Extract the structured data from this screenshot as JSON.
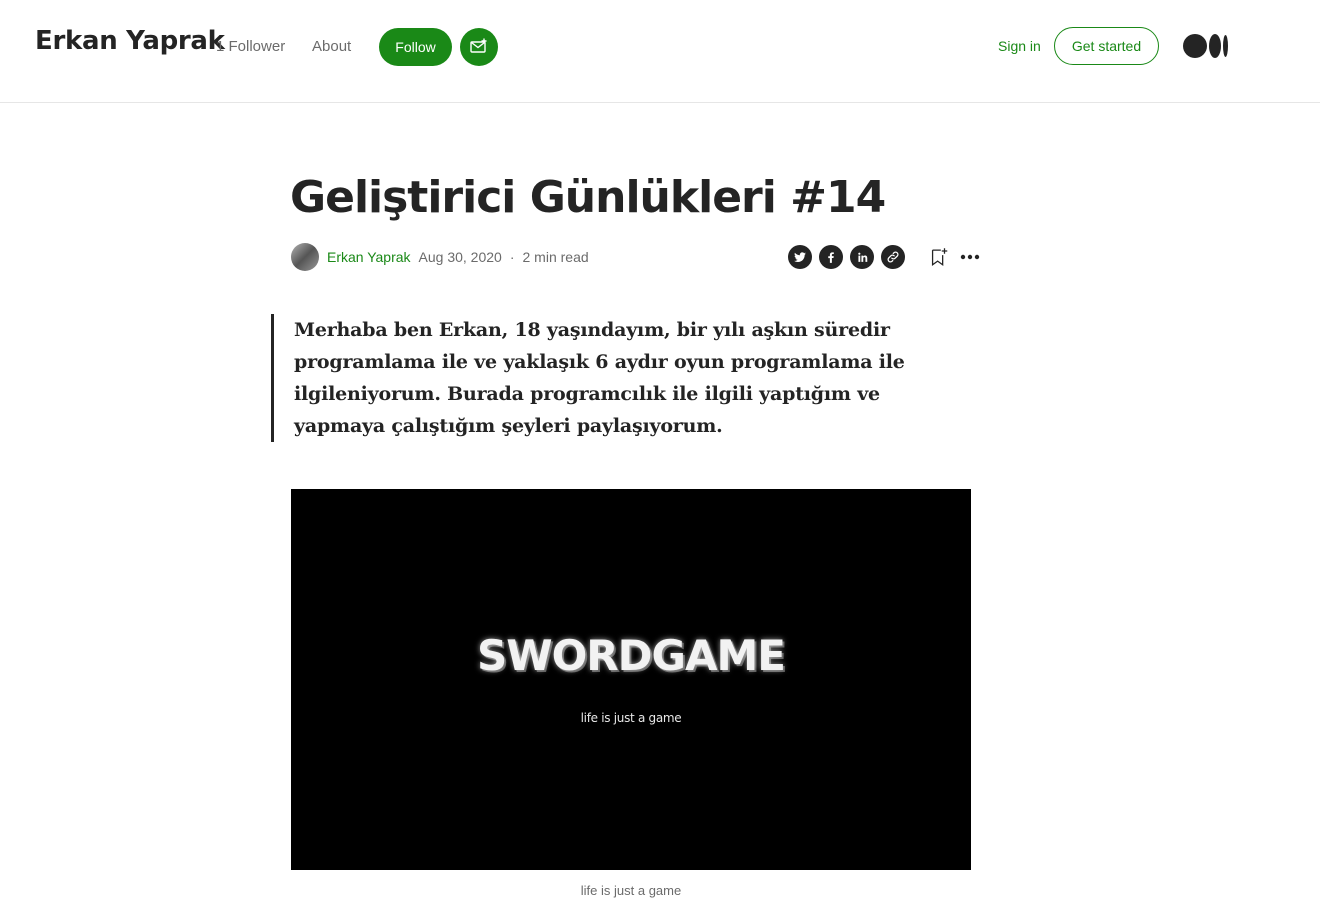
{
  "header": {
    "site_title": "Erkan Yaprak",
    "followers": "1 Follower",
    "about": "About",
    "follow_label": "Follow",
    "sign_in": "Sign in",
    "get_started": "Get started"
  },
  "article": {
    "title": "Geliştirici Günlükleri #14",
    "author": "Erkan Yaprak",
    "date": "Aug 30, 2020",
    "separator": "·",
    "read_time": "2 min read",
    "quote": "Merhaba ben Erkan, 18 yaşındayım, bir yılı aşkın süredir programlama ile ve yaklaşık 6 aydır oyun programlama ile ilgileniyorum. Burada programcılık ile ilgili yaptığım ve yapmaya çalıştığım şeyleri paylaşıyorum.",
    "image_title": "SWORDGAME",
    "image_tagline": "life is just a game",
    "caption": "life is just a game"
  },
  "colors": {
    "accent": "#1a8917",
    "text": "#242424",
    "muted": "#6b6b6b"
  },
  "icons": [
    "subscribe-mail-icon",
    "medium-logo",
    "twitter-icon",
    "facebook-icon",
    "linkedin-icon",
    "link-icon",
    "bookmark-icon",
    "more-icon"
  ]
}
